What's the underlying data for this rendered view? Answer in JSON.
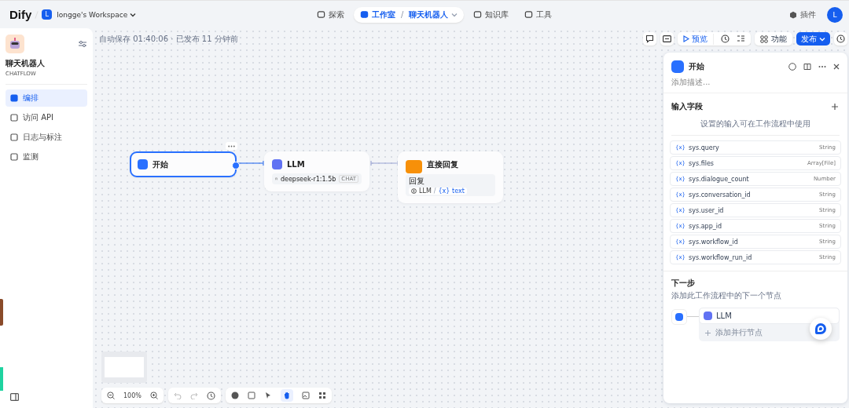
{
  "header": {
    "logo": "Dify",
    "workspace": {
      "avatar": "L",
      "name": "longge's Workspace"
    },
    "nav": [
      {
        "label": "探索",
        "selected": false
      },
      {
        "label": "工作室",
        "selected": true,
        "separator": "/",
        "app": "聊天机器人"
      },
      {
        "label": "知识库",
        "selected": false
      },
      {
        "label": "工具",
        "selected": false
      }
    ],
    "plugins": "插件",
    "user_avatar": "L"
  },
  "sidebar": {
    "app_name": "聊天机器人",
    "app_type": "CHATFLOW",
    "items": [
      {
        "label": "编排",
        "selected": true
      },
      {
        "label": "访问 API",
        "selected": false
      },
      {
        "label": "日志与标注",
        "selected": false
      },
      {
        "label": "监测",
        "selected": false
      }
    ]
  },
  "canvas": {
    "autosave": "自动保存 01:40:06 · 已发布 11 分钟前",
    "toolbar": {
      "preview": "预览",
      "features": "功能",
      "publish": "发布"
    },
    "nodes": [
      {
        "kind": "start",
        "title": "开始",
        "selected": true
      },
      {
        "kind": "llm",
        "title": "LLM",
        "model": "deepseek-r1:1.5b",
        "tag": "CHAT",
        "selected": false
      },
      {
        "kind": "answer",
        "title": "直接回复",
        "field": "回复",
        "ref_node": "LLM",
        "separator": "/",
        "marker": "{x}",
        "ref_var": "text",
        "selected": false
      }
    ],
    "zoom": "100%"
  },
  "panel": {
    "title": "开始",
    "description_placeholder": "添加描述...",
    "inputs_title": "输入字段",
    "inputs_hint": "设置的输入可在工作流程中使用",
    "variables": [
      {
        "marker": "{x}",
        "name": "sys.query",
        "type": "String"
      },
      {
        "marker": "{x}",
        "name": "sys.files",
        "type": "Array[File]"
      },
      {
        "marker": "{x}",
        "name": "sys.dialogue_count",
        "type": "Number"
      },
      {
        "marker": "{x}",
        "name": "sys.conversation_id",
        "type": "String"
      },
      {
        "marker": "{x}",
        "name": "sys.user_id",
        "type": "String"
      },
      {
        "marker": "{x}",
        "name": "sys.app_id",
        "type": "String"
      },
      {
        "marker": "{x}",
        "name": "sys.workflow_id",
        "type": "String"
      },
      {
        "marker": "{x}",
        "name": "sys.workflow_run_id",
        "type": "String"
      }
    ],
    "next_title": "下一步",
    "next_hint": "添加此工作流程中的下一个节点",
    "next_node": "LLM",
    "add_parallel": "添加并行节点"
  }
}
